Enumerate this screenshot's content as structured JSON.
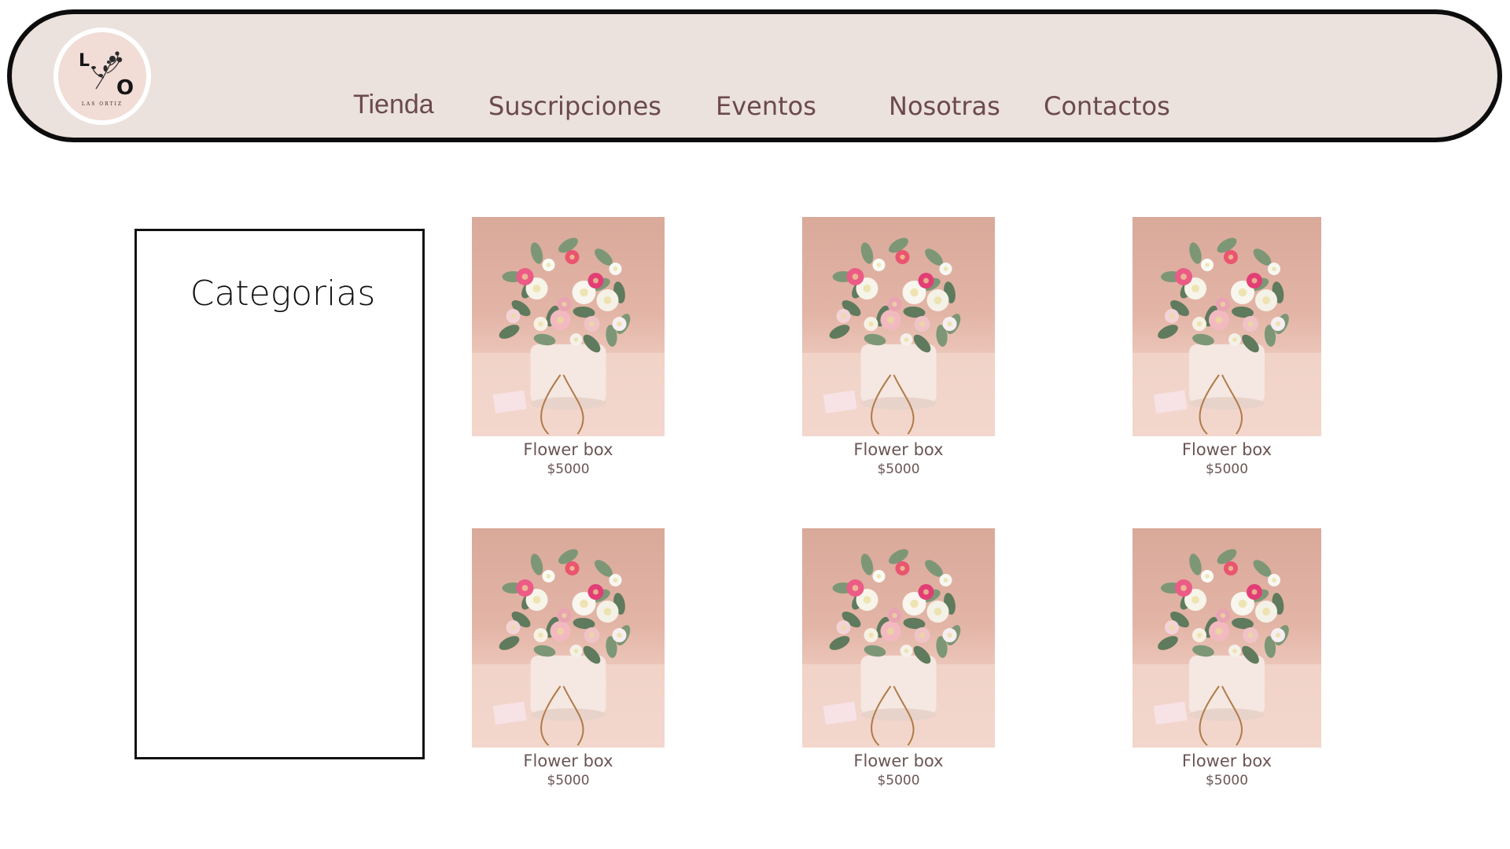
{
  "brand": {
    "logo_letters": [
      "L",
      "O"
    ],
    "logo_text": "LAS ORTIZ"
  },
  "nav": {
    "items": [
      {
        "label": "Tienda"
      },
      {
        "label": "Suscripciones"
      },
      {
        "label": "Eventos"
      },
      {
        "label": "Nosotras"
      },
      {
        "label": "Contactos"
      }
    ]
  },
  "sidebar": {
    "title": "Categorias"
  },
  "products": [
    {
      "name": "Flower box",
      "price": "$5000"
    },
    {
      "name": "Flower box",
      "price": "$5000"
    },
    {
      "name": "Flower box",
      "price": "$5000"
    },
    {
      "name": "Flower box",
      "price": "$5000"
    },
    {
      "name": "Flower box",
      "price": "$5000"
    },
    {
      "name": "Flower box",
      "price": "$5000"
    }
  ],
  "colors": {
    "header_bg": "#ebe1dd",
    "header_border": "#0d0d0d",
    "nav_text": "#6b4a4a",
    "product_text": "#6b5555"
  }
}
